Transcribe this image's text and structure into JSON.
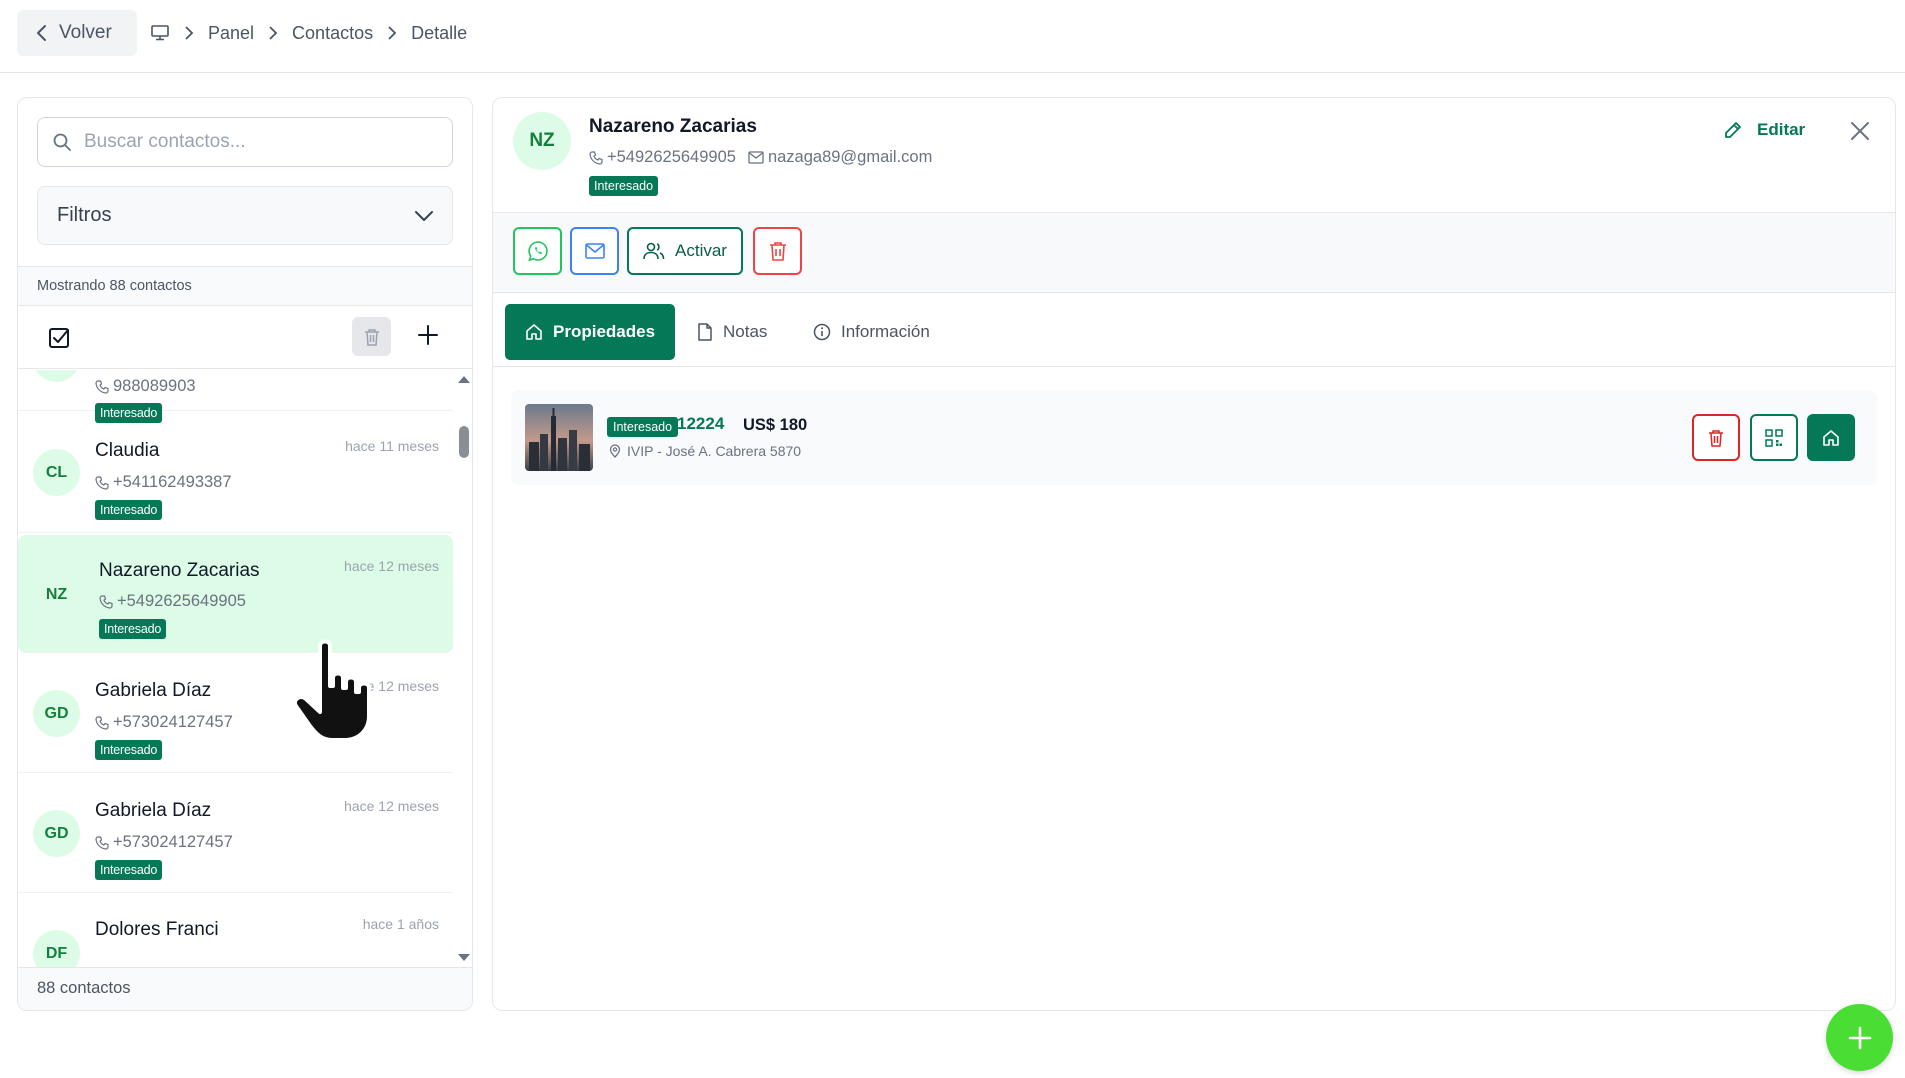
{
  "topbar": {
    "back_label": "Volver",
    "breadcrumbs": [
      "Panel",
      "Contactos",
      "Detalle"
    ]
  },
  "left": {
    "search_placeholder": "Buscar contactos...",
    "filter_label": "Filtros",
    "showing_text": "Mostrando 88 contactos",
    "footer_count": "88 contactos",
    "contacts": [
      {
        "initials": "AS",
        "name": "",
        "time": "",
        "phone": "988089903",
        "status": "Interesado"
      },
      {
        "initials": "CL",
        "name": "Claudia",
        "time": "hace 11 meses",
        "phone": "+541162493387",
        "status": "Interesado"
      },
      {
        "initials": "NZ",
        "name": "Nazareno Zacarias",
        "time": "hace 12 meses",
        "phone": "+5492625649905",
        "status": "Interesado"
      },
      {
        "initials": "GD",
        "name": "Gabriela Díaz",
        "time": "hace 12 meses",
        "phone": "+573024127457",
        "status": "Interesado"
      },
      {
        "initials": "GD",
        "name": "Gabriela Díaz",
        "time": "hace 12 meses",
        "phone": "+573024127457",
        "status": "Interesado"
      },
      {
        "initials": "DF",
        "name": "Dolores Franci",
        "time": "hace 1 años",
        "phone": "",
        "status": ""
      }
    ]
  },
  "detail": {
    "initials": "NZ",
    "name": "Nazareno Zacarias",
    "phone": "+5492625649905",
    "email": "nazaga89@gmail.com",
    "status": "Interesado",
    "edit_label": "Editar",
    "activate_label": "Activar",
    "tabs": [
      "Propiedades",
      "Notas",
      "Información"
    ],
    "property": {
      "status": "Interesado",
      "code": "12224",
      "price": "US$ 180",
      "address": "IVIP - José A. Cabrera 5870"
    }
  },
  "colors": {
    "brand_green": "#047857",
    "active_row": "#dcfce7",
    "fab": "#4ade34",
    "danger": "#ef4444"
  }
}
